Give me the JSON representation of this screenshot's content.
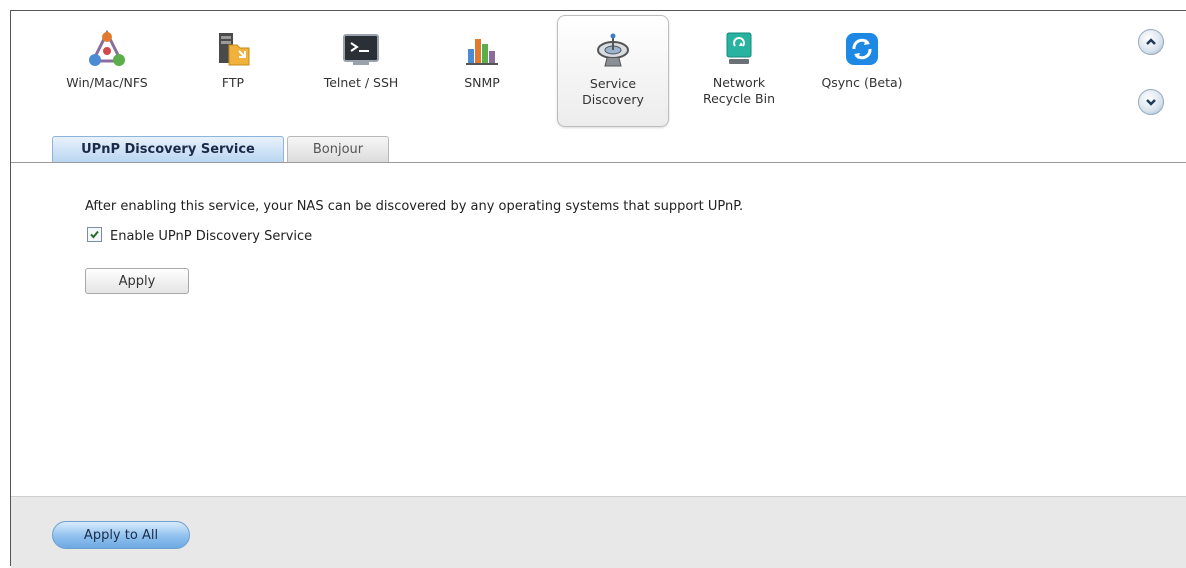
{
  "toolbar": {
    "items": [
      {
        "label": "Win/Mac/NFS",
        "icon": "network-share-icon"
      },
      {
        "label": "FTP",
        "icon": "ftp-folder-icon"
      },
      {
        "label": "Telnet / SSH",
        "icon": "terminal-icon"
      },
      {
        "label": "SNMP",
        "icon": "bar-chart-icon"
      },
      {
        "label": "Service\nDiscovery",
        "icon": "satellite-dish-icon",
        "active": true
      },
      {
        "label": "Network\nRecycle Bin",
        "icon": "recycle-bin-icon"
      },
      {
        "label": "Qsync (Beta)",
        "icon": "sync-icon"
      }
    ],
    "scroll_up_icon": "chevron-up-icon",
    "scroll_down_icon": "chevron-down-icon"
  },
  "tabs": [
    {
      "label": "UPnP Discovery Service",
      "active": true
    },
    {
      "label": "Bonjour",
      "active": false
    }
  ],
  "content": {
    "description": "After enabling this service, your NAS can be discovered by any operating systems that support UPnP.",
    "checkbox_label": "Enable UPnP Discovery Service",
    "checkbox_checked": true,
    "apply_label": "Apply"
  },
  "footer": {
    "apply_all_label": "Apply to All"
  },
  "colors": {
    "active_tab": "#b9d6f1",
    "apply_all": "#8fc0ee",
    "footer_bg": "#e8e8e8"
  }
}
